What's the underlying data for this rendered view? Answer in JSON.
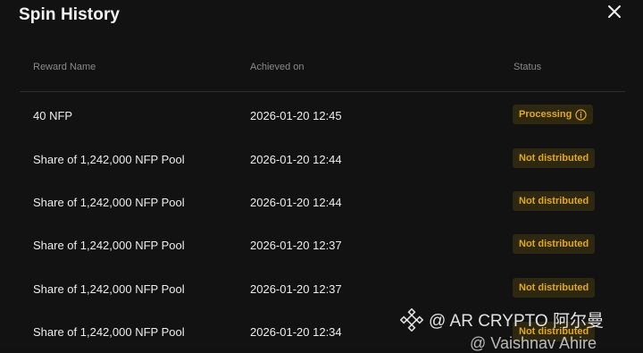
{
  "modal": {
    "title": "Spin History"
  },
  "table": {
    "headers": {
      "reward_name": "Reward Name",
      "achieved_on": "Achieved on",
      "status": "Status"
    },
    "rows": [
      {
        "reward": "40 NFP",
        "date": "2026-01-20 12:45",
        "status": "Processing",
        "status_icon": "info-icon"
      },
      {
        "reward": "Share of 1,242,000 NFP Pool",
        "date": "2026-01-20 12:44",
        "status": "Not distributed"
      },
      {
        "reward": "Share of 1,242,000 NFP Pool",
        "date": "2026-01-20 12:44",
        "status": "Not distributed"
      },
      {
        "reward": "Share of 1,242,000 NFP Pool",
        "date": "2026-01-20 12:37",
        "status": "Not distributed"
      },
      {
        "reward": "Share of 1,242,000 NFP Pool",
        "date": "2026-01-20 12:37",
        "status": "Not distributed"
      },
      {
        "reward": "Share of 1,242,000 NFP Pool",
        "date": "2026-01-20 12:34",
        "status": "Not distributed"
      }
    ]
  },
  "watermark": {
    "line1": "@ AR CRYPTO 阿尔曼",
    "line2": "@ Vaishnav Ahire",
    "icon": "binance-diamond-icon"
  },
  "colors": {
    "background": "#121212",
    "badge_bg": "#2f2810",
    "badge_text": "#e2a81c"
  }
}
